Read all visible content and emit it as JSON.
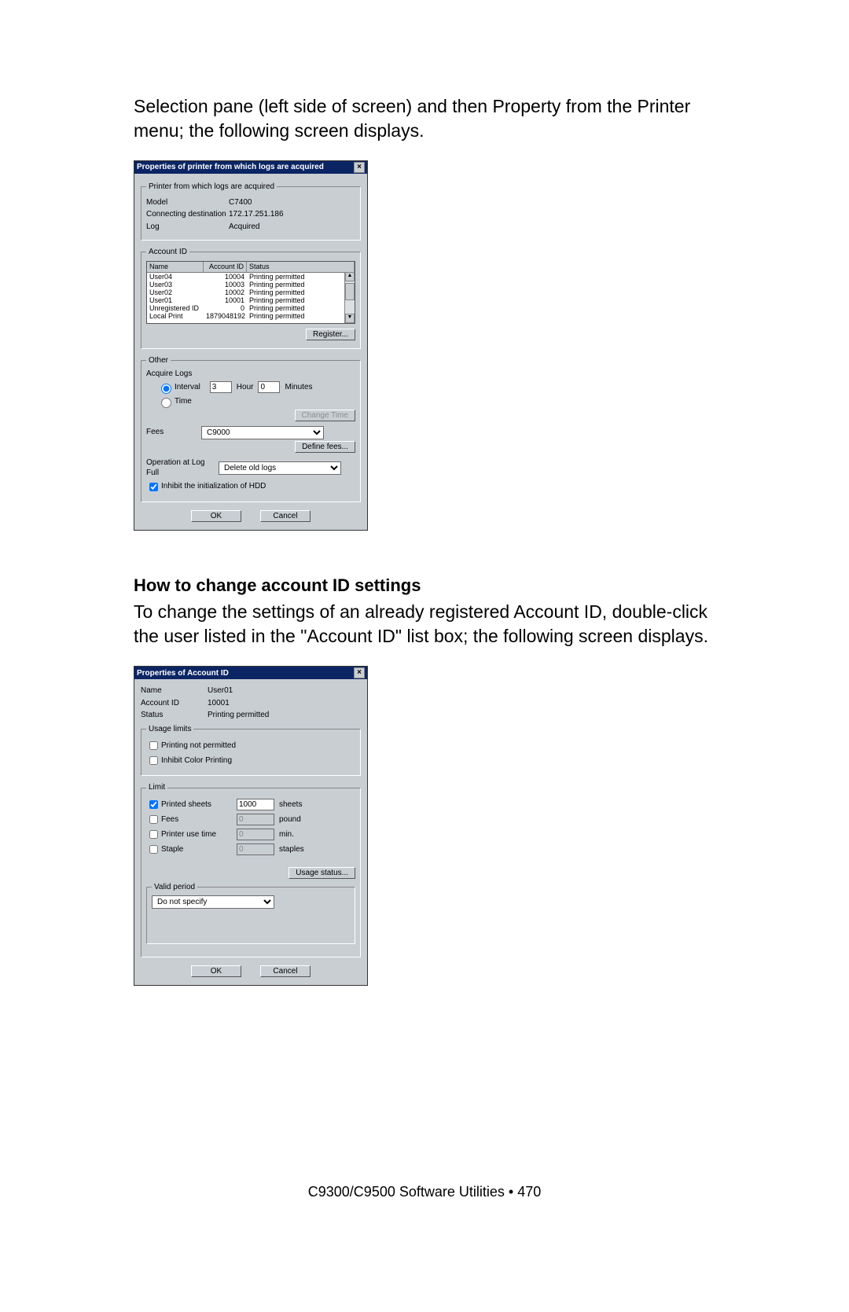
{
  "intro_text": "Selection pane (left side of screen) and then Property from the Printer menu; the following screen displays.",
  "subheading": "How to change account ID settings",
  "subtext": "To change the settings of an already registered Account ID, double-click the user listed in the \"Account ID\" list box; the following screen displays.",
  "footer": "C9300/C9500 Software Utilities  •  470",
  "dlg1": {
    "title": "Properties of printer from which logs are acquired",
    "groups": {
      "printer": {
        "legend": "Printer from which logs are acquired",
        "model_label": "Model",
        "model_value": "C7400",
        "conn_label": "Connecting destination",
        "conn_value": "172.17.251.186",
        "log_label": "Log",
        "log_value": "Acquired"
      },
      "account": {
        "legend": "Account ID",
        "col_name": "Name",
        "col_acct": "Account ID",
        "col_status": "Status",
        "rows": [
          {
            "name": "User04",
            "acct": "10004",
            "status": "Printing permitted"
          },
          {
            "name": "User03",
            "acct": "10003",
            "status": "Printing permitted"
          },
          {
            "name": "User02",
            "acct": "10002",
            "status": "Printing permitted"
          },
          {
            "name": "User01",
            "acct": "10001",
            "status": "Printing permitted"
          },
          {
            "name": "Unregistered ID",
            "acct": "0",
            "status": "Printing permitted"
          },
          {
            "name": "Local Print",
            "acct": "1879048192",
            "status": "Printing permitted"
          }
        ],
        "register": "Register..."
      },
      "other": {
        "legend": "Other",
        "acquire_label": "Acquire Logs",
        "interval_label": "Interval",
        "interval_hour": "3",
        "hour_label": "Hour",
        "interval_min": "0",
        "min_label": "Minutes",
        "time_label": "Time",
        "change_time": "Change Time",
        "fees_label": "Fees",
        "fees_value": "C9000",
        "define_fees": "Define fees...",
        "op_label": "Operation at Log Full",
        "op_value": "Delete old logs",
        "inhibit_label": "Inhibit the initialization of HDD"
      }
    },
    "ok": "OK",
    "cancel": "Cancel"
  },
  "dlg2": {
    "title": "Properties of Account ID",
    "name_label": "Name",
    "name_value": "User01",
    "acct_label": "Account ID",
    "acct_value": "10001",
    "status_label": "Status",
    "status_value": "Printing permitted",
    "usage_legend": "Usage limits",
    "printing_not": "Printing not permitted",
    "inhibit_color": "Inhibit Color Printing",
    "limit_legend": "Limit",
    "printed_sheets": "Printed sheets",
    "printed_value": "1000",
    "sheets_unit": "sheets",
    "fees": "Fees",
    "fees_value": "0",
    "pound_unit": "pound",
    "printer_use": "Printer use time",
    "printer_use_value": "0",
    "min_unit": "min.",
    "staple": "Staple",
    "staple_value": "0",
    "staples_unit": "staples",
    "usage_status": "Usage status...",
    "valid_legend": "Valid period",
    "valid_value": "Do not specify",
    "ok": "OK",
    "cancel": "Cancel"
  }
}
